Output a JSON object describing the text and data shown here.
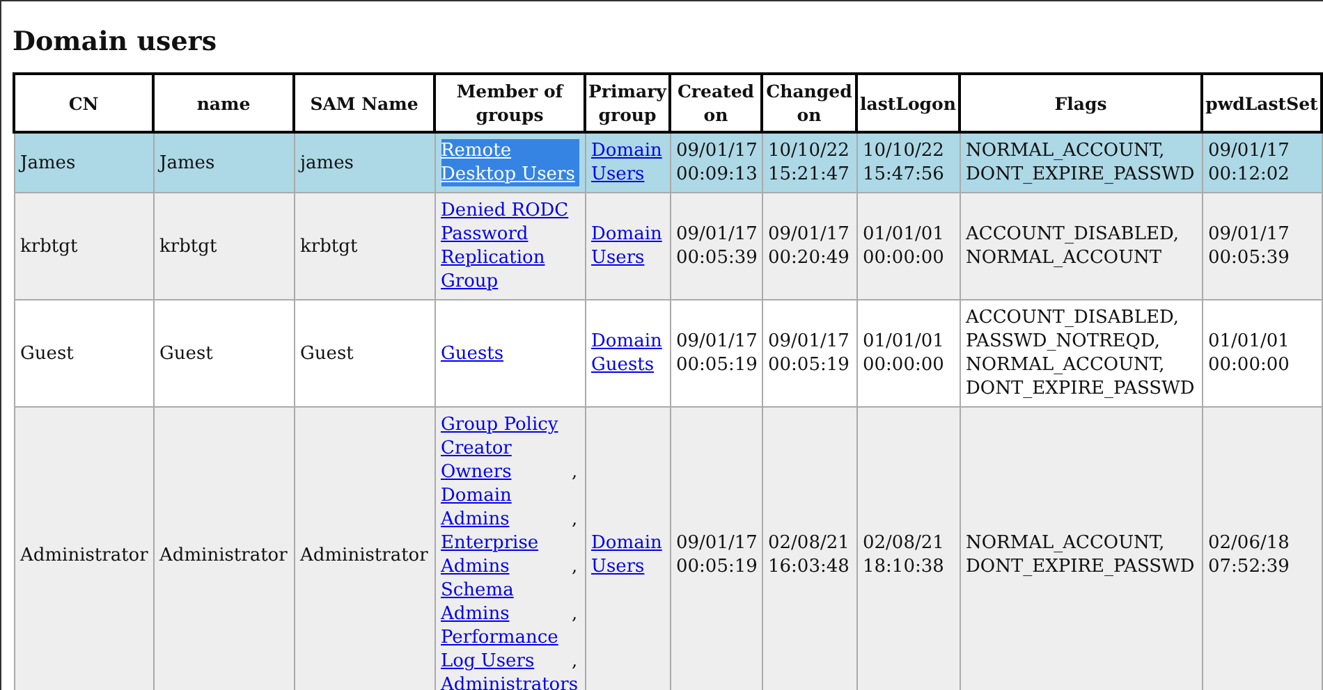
{
  "title": "Domain users",
  "table": {
    "columns": [
      "CN",
      "name",
      "SAM Name",
      "Member of groups",
      "Primary group",
      "Created on",
      "Changed on",
      "lastLogon",
      "Flags",
      "pwdLastSet"
    ],
    "rows": [
      {
        "selected": true,
        "cn": "James",
        "name": "James",
        "sam_name": "james",
        "groups": [
          {
            "name": "Remote Desktop Users",
            "text_selected": true
          }
        ],
        "primary_group": "Domain Users",
        "created_on": "09/01/17 00:09:13",
        "changed_on": "10/10/22 15:21:47",
        "last_logon": "10/10/22 15:47:56",
        "flags": "NORMAL_ACCOUNT, DONT_EXPIRE_PASSWD",
        "pwd_last_set": "09/01/17 00:12:02"
      },
      {
        "selected": false,
        "cn": "krbtgt",
        "name": "krbtgt",
        "sam_name": "krbtgt",
        "groups": [
          {
            "name": "Denied RODC Password Replication Group",
            "text_selected": false
          }
        ],
        "primary_group": "Domain Users",
        "created_on": "09/01/17 00:05:39",
        "changed_on": "09/01/17 00:20:49",
        "last_logon": "01/01/01 00:00:00",
        "flags": "ACCOUNT_DISABLED, NORMAL_ACCOUNT",
        "pwd_last_set": "09/01/17 00:05:39"
      },
      {
        "selected": false,
        "cn": "Guest",
        "name": "Guest",
        "sam_name": "Guest",
        "groups": [
          {
            "name": "Guests",
            "text_selected": false
          }
        ],
        "primary_group": "Domain Guests",
        "created_on": "09/01/17 00:05:19",
        "changed_on": "09/01/17 00:05:19",
        "last_logon": "01/01/01 00:00:00",
        "flags": "ACCOUNT_DISABLED, PASSWD_NOTREQD, NORMAL_ACCOUNT, DONT_EXPIRE_PASSWD",
        "pwd_last_set": "01/01/01 00:00:00"
      },
      {
        "selected": false,
        "cn": "Administrator",
        "name": "Administrator",
        "sam_name": "Administrator",
        "groups": [
          {
            "name": "Group Policy Creator Owners",
            "separator": ",",
            "text_selected": false
          },
          {
            "name": "Domain Admins",
            "separator": ",",
            "text_selected": false
          },
          {
            "name": "Enterprise Admins",
            "separator": ",",
            "text_selected": false
          },
          {
            "name": "Schema Admins",
            "separator": ",",
            "text_selected": false
          },
          {
            "name": "Performance Log Users",
            "separator": ",",
            "text_selected": false
          },
          {
            "name": "Administrators",
            "text_selected": false
          }
        ],
        "primary_group": "Domain Users",
        "created_on": "09/01/17 00:05:19",
        "changed_on": "02/08/21 16:03:48",
        "last_logon": "02/08/21 18:10:38",
        "flags": "NORMAL_ACCOUNT, DONT_EXPIRE_PASSWD",
        "pwd_last_set": "02/06/18 07:52:39"
      }
    ]
  }
}
